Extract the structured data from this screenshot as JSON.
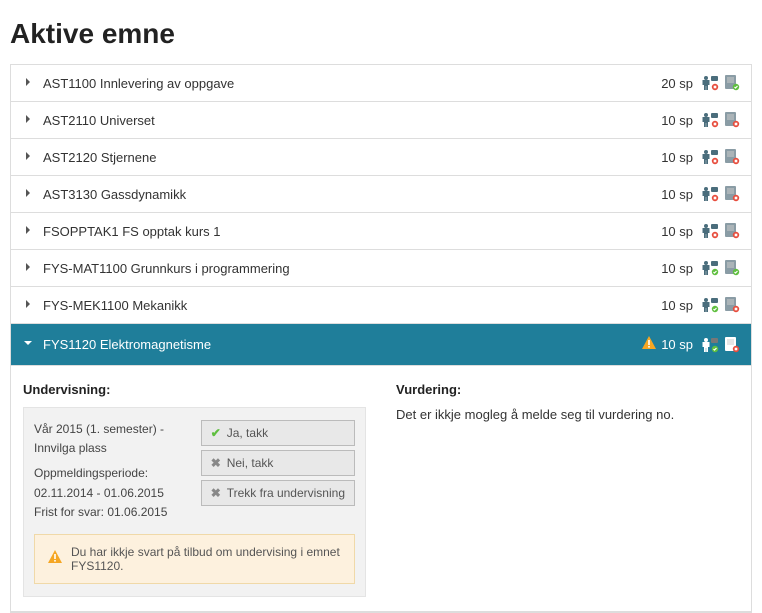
{
  "heading": "Aktive emne",
  "courses": [
    {
      "title": "AST1100 Innlevering av oppgave",
      "credits": "20 sp",
      "expanded": false,
      "person_status": "red",
      "doc_status": "green",
      "warning": false
    },
    {
      "title": "AST2110 Universet",
      "credits": "10 sp",
      "expanded": false,
      "person_status": "red",
      "doc_status": "red",
      "warning": false
    },
    {
      "title": "AST2120 Stjernene",
      "credits": "10 sp",
      "expanded": false,
      "person_status": "red",
      "doc_status": "red",
      "warning": false
    },
    {
      "title": "AST3130 Gassdynamikk",
      "credits": "10 sp",
      "expanded": false,
      "person_status": "red",
      "doc_status": "red",
      "warning": false
    },
    {
      "title": "FSOPPTAK1 FS opptak kurs 1",
      "credits": "10 sp",
      "expanded": false,
      "person_status": "red",
      "doc_status": "red",
      "warning": false
    },
    {
      "title": "FYS-MAT1100 Grunnkurs i programmering",
      "credits": "10 sp",
      "expanded": false,
      "person_status": "green",
      "doc_status": "green",
      "warning": false
    },
    {
      "title": "FYS-MEK1100 Mekanikk",
      "credits": "10 sp",
      "expanded": false,
      "person_status": "green",
      "doc_status": "red",
      "warning": false
    },
    {
      "title": "FYS1120 Elektromagnetisme",
      "credits": "10 sp",
      "expanded": true,
      "person_status": "green-white",
      "doc_status": "red-white",
      "warning": true
    }
  ],
  "detail": {
    "undervisning_label": "Undervisning:",
    "vurdering_label": "Vurdering:",
    "semester_line": "Vår 2015 (1. semester) - Innvilga plass",
    "period_line": "Oppmeldingsperiode: 02.11.2014 - 01.06.2015",
    "deadline_line": "Frist for svar: 01.06.2015",
    "btn_yes": "Ja, takk",
    "btn_no": "Nei, takk",
    "btn_withdraw": "Trekk fra undervisning",
    "alert_text": "Du har ikkje svart på tilbud om undervising i emnet FYS1120.",
    "vurdering_text": "Det er ikkje mogleg å melde seg til vurdering no."
  }
}
